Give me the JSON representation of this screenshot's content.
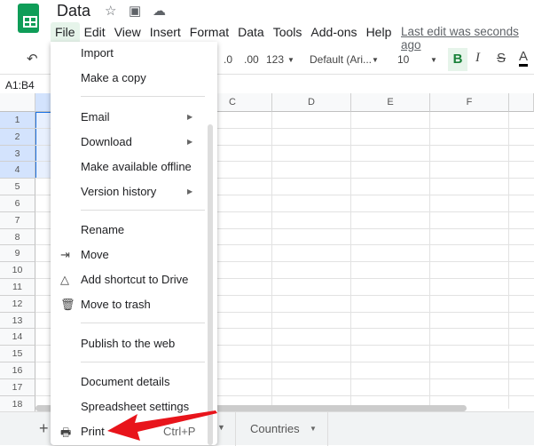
{
  "doc": {
    "title": "Data",
    "last_edit": "Last edit was seconds ago"
  },
  "menubar": [
    "File",
    "Edit",
    "View",
    "Insert",
    "Format",
    "Data",
    "Tools",
    "Add-ons",
    "Help"
  ],
  "toolbar": {
    "decrease_decimal": ".0",
    "increase_decimal": ".00",
    "number_format": "123",
    "font": "Default (Ari...",
    "font_size": "10",
    "bold": "B",
    "italic": "I",
    "strike": "S",
    "text_color": "A"
  },
  "name_box": "A1:B4",
  "columns": [
    "C",
    "D",
    "E",
    "F"
  ],
  "rows": [
    "1",
    "2",
    "3",
    "4",
    "5",
    "6",
    "7",
    "8",
    "9",
    "10",
    "11",
    "12",
    "13",
    "14",
    "15",
    "16",
    "17",
    "18"
  ],
  "file_menu": {
    "import": "Import",
    "copy": "Make a copy",
    "email": "Email",
    "download": "Download",
    "offline": "Make available offline",
    "version": "Version history",
    "rename": "Rename",
    "move": "Move",
    "shortcut": "Add shortcut to Drive",
    "trash": "Move to trash",
    "publish": "Publish to the web",
    "details": "Document details",
    "settings": "Spreadsheet settings",
    "print": "Print",
    "print_shortcut": "Ctrl+P"
  },
  "sheet_tabs": {
    "add": "+",
    "tab": "Countries"
  },
  "colors": {
    "accent": "#0f9d58",
    "annotation_arrow": "#e8141b",
    "selection": "#e8f0fe"
  }
}
